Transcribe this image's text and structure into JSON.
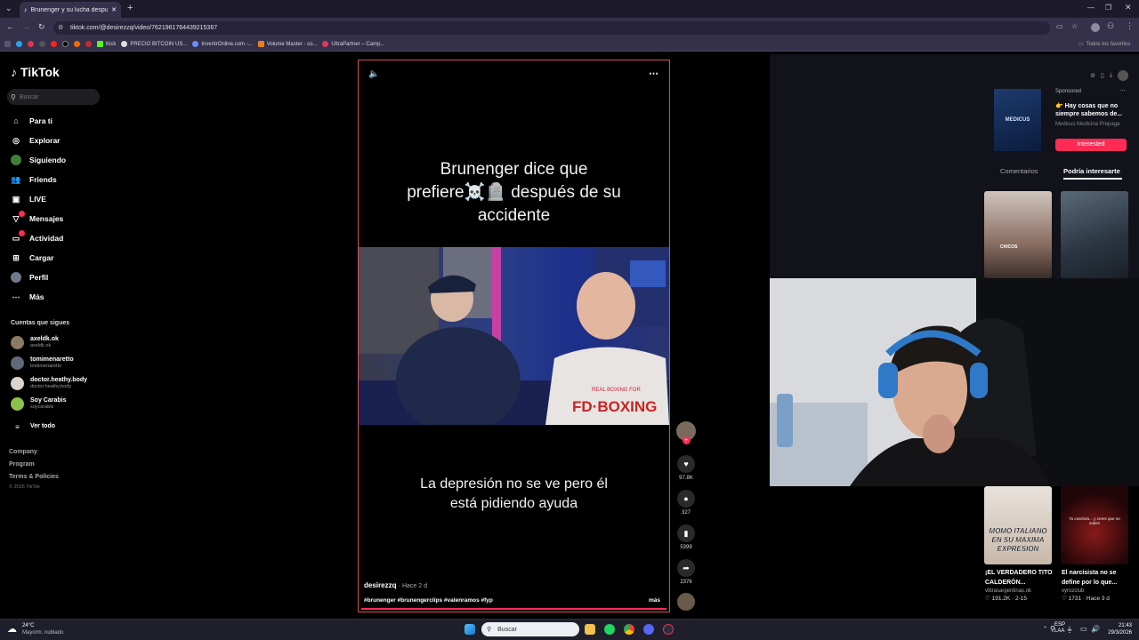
{
  "browser": {
    "tab_title": "Brunenger y su lucha después d",
    "url": "tiktok.com/@desirezzq/video/7621961764439215367",
    "bookmarks": [
      "Kick",
      "PRECIO BITCOIN US...",
      "InvertirOnline.com -...",
      "Volume Master - co...",
      "UltraPartner – Camp..."
    ],
    "all_bookmarks": "Todos los favoritos"
  },
  "sidebar": {
    "logo": "TikTok",
    "search_placeholder": "Buscar",
    "nav": [
      {
        "label": "Para ti",
        "icon": "home-icon"
      },
      {
        "label": "Explorar",
        "icon": "compass-icon"
      },
      {
        "label": "Siguiendo",
        "icon": "following-icon"
      },
      {
        "label": "Friends",
        "icon": "friends-icon"
      },
      {
        "label": "LIVE",
        "icon": "live-icon"
      },
      {
        "label": "Mensajes",
        "icon": "messages-icon"
      },
      {
        "label": "Actividad",
        "icon": "activity-icon"
      },
      {
        "label": "Cargar",
        "icon": "upload-icon"
      },
      {
        "label": "Perfil",
        "icon": "profile-icon"
      },
      {
        "label": "Más",
        "icon": "more-icon"
      }
    ],
    "following_title": "Cuentas que sigues",
    "accounts": [
      {
        "name": "axeldk.ok",
        "handle": "axeldk.ok"
      },
      {
        "name": "tomimenaretto",
        "handle": "tomimenaretto"
      },
      {
        "name": "doctor.heathy.body",
        "handle": "doctor.heathy.body"
      },
      {
        "name": "Soy Carabis",
        "handle": "soycarabis"
      }
    ],
    "see_all": "Ver todo",
    "footer": [
      "Company",
      "Program",
      "Terms & Policies"
    ],
    "copyright": "© 2026 TikTok"
  },
  "video": {
    "title_line1": "Brunenger dice que",
    "title_line2": "prefiere☠️🪦 después de su",
    "title_line3": "accidente",
    "subtitle_line1": "La depresión no se ve pero él",
    "subtitle_line2": "está pidiendo ayuda",
    "shirt_text": "FD·BOXING",
    "shirt_small": "REAL BOXING FOR",
    "author": "desirezzq",
    "time_ago": "· Hace 2 d",
    "hashtags": "#brunenger #brunengerclips #valenramos #fyp",
    "more": "más"
  },
  "actions": {
    "likes": "97.8K",
    "comments": "327",
    "saves": "5399",
    "shares": "2376"
  },
  "right_panel": {
    "ad_sponsored": "Sponsored",
    "ad_text": "👉 Hay cosas que no siempre sabemos de...",
    "ad_brand": "Medicus Medicina Prepaga",
    "ad_image_label": "MEDICUS",
    "ad_button": "Interested",
    "tab_comments": "Comentarios",
    "tab_foryou": "Podría interesarte",
    "thumb_label": "CHICOS",
    "recs": [
      {
        "thumb_text": "MOMO ITALIANO EN SU MAXIMA EXPRESION",
        "title": "¡EL VERDADERO TITO CALDERÓN...",
        "author": "vibrasargentinas.ok",
        "likes": "191.2K",
        "date": "2-15"
      },
      {
        "thumb_text": "Tu castrista... y crees que no sabes",
        "title": "El narcisista no se define por lo que...",
        "author": "xyrozclub",
        "likes": "1731",
        "date": "Hace 3 d"
      }
    ]
  },
  "taskbar": {
    "temp": "24°C",
    "weather": "Mayorm. nublado",
    "search": "Buscar",
    "lang1": "ESP",
    "lang2": "LAA",
    "time": "21:43",
    "date": "29/3/2026"
  },
  "colors": {
    "accent": "#fe2c55",
    "video_border": "#d84b5a",
    "browser": "#35314a"
  }
}
